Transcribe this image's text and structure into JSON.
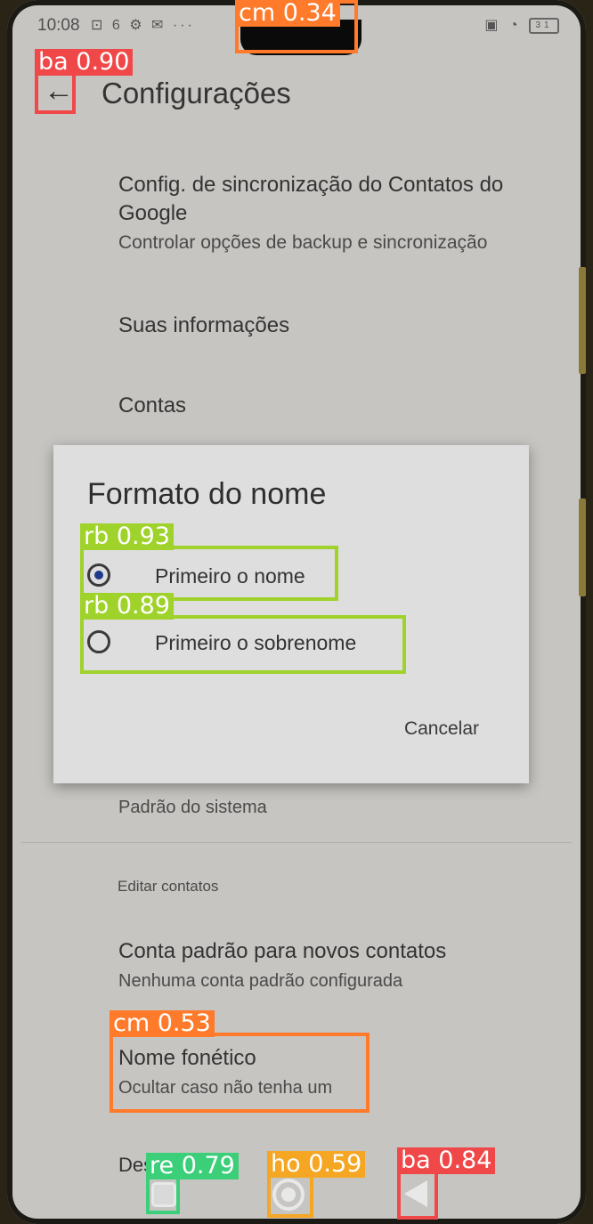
{
  "status_bar": {
    "time": "10:08",
    "left_icons": "⊡ 6 ⚙ ✉ ···",
    "right_icons": "▣ ◔",
    "battery": "31"
  },
  "app_bar": {
    "title": "Configurações"
  },
  "settings": [
    {
      "title": "Config. de sincronização do Contatos do Google",
      "subtitle": "Controlar opções de backup e sincronização"
    },
    {
      "title": "Suas informações"
    },
    {
      "title": "Contas"
    },
    {
      "title": "Padrão do sistema"
    },
    {
      "title": "Conta padrão para novos contatos",
      "subtitle": "Nenhuma conta padrão configurada"
    },
    {
      "title": "Nome fonético",
      "subtitle": "Ocultar caso não tenha um"
    },
    {
      "title": "Des"
    }
  ],
  "sections": {
    "edit_contacts": "Editar contatos"
  },
  "dialog": {
    "title": "Formato do nome",
    "options": [
      {
        "label": "Primeiro o nome",
        "checked": true
      },
      {
        "label": "Primeiro o sobrenome",
        "checked": false
      }
    ],
    "cancel": "Cancelar"
  },
  "detections": [
    {
      "label": "cm 0.34",
      "color": "#ff7a2a"
    },
    {
      "label": "ba 0.90",
      "color": "#f04848"
    },
    {
      "label": "rb 0.93",
      "color": "#a0d22c"
    },
    {
      "label": "rb 0.89",
      "color": "#a0d22c"
    },
    {
      "label": "cm 0.53",
      "color": "#ff7a2a"
    },
    {
      "label": "re 0.79",
      "color": "#3ccf7a"
    },
    {
      "label": "ho 0.59",
      "color": "#f5a623"
    },
    {
      "label": "ba 0.84",
      "color": "#f04848"
    }
  ]
}
